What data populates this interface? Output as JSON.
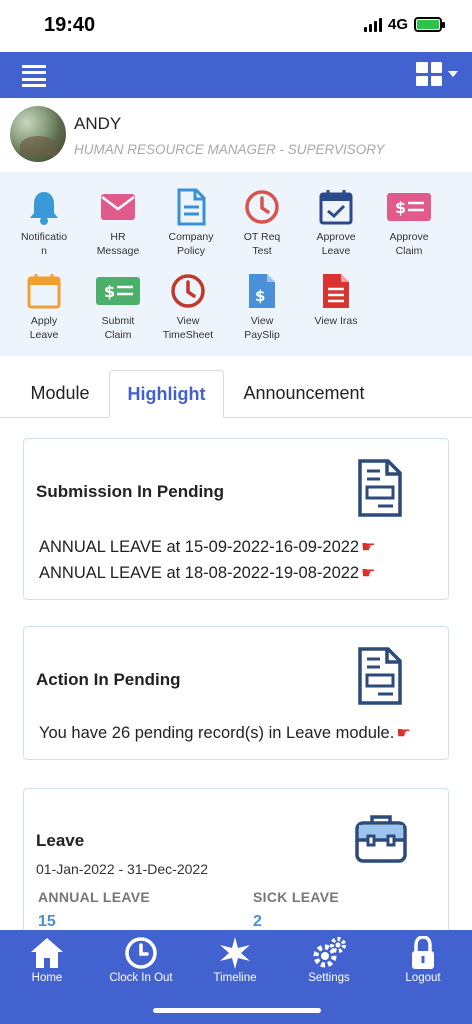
{
  "status": {
    "time": "19:40",
    "network": "4G",
    "battery_level": 0.9
  },
  "header": {
    "menu_icon": "hamburger-icon",
    "apps_icon": "grid-icon"
  },
  "profile": {
    "name": "ANDY",
    "role": "HUMAN RESOURCE MANAGER - SUPERVISORY"
  },
  "quick_actions": [
    {
      "label": "Notificatio\nn",
      "icon": "bell-icon",
      "color": "#3a9ad9"
    },
    {
      "label": "HR\nMessage",
      "icon": "envelope-icon",
      "color": "#e05a8a"
    },
    {
      "label": "Company\nPolicy",
      "icon": "document-icon",
      "color": "#3a8fd9"
    },
    {
      "label": "OT Req\nTest",
      "icon": "clock-icon",
      "color": "#d9534f"
    },
    {
      "label": "Approve\nLeave",
      "icon": "calendar-check-icon",
      "color": "#2c4a8a"
    },
    {
      "label": "Approve\nClaim",
      "icon": "money-bill-icon",
      "color": "#e05a8a"
    },
    {
      "label": "Apply\nLeave",
      "icon": "calendar-icon",
      "color": "#f0a030"
    },
    {
      "label": "Submit\nClaim",
      "icon": "money-bill-icon",
      "color": "#4caf6a"
    },
    {
      "label": "View\nTimeSheet",
      "icon": "clock-icon",
      "color": "#c0392b"
    },
    {
      "label": "View\nPaySlip",
      "icon": "payslip-icon",
      "color": "#4a90d9"
    },
    {
      "label": "View Iras",
      "icon": "document-text-icon",
      "color": "#d9342f"
    }
  ],
  "tabs": [
    "Module",
    "Highlight",
    "Announcement"
  ],
  "active_tab": "Highlight",
  "cards": {
    "submission": {
      "title": "Submission In Pending",
      "items": [
        "ANNUAL LEAVE at 15-09-2022-16-09-2022",
        "ANNUAL LEAVE at 18-08-2022-19-08-2022"
      ]
    },
    "action": {
      "title": "Action In Pending",
      "text": "You have 26 pending record(s) in Leave module."
    },
    "leave": {
      "title": "Leave",
      "period": "01-Jan-2022 - 31-Dec-2022",
      "types": [
        {
          "label": "ANNUAL LEAVE",
          "value": "15"
        },
        {
          "label": "SICK LEAVE",
          "value": "2"
        }
      ]
    }
  },
  "bottom_nav": [
    {
      "label": "Home",
      "icon": "home-icon"
    },
    {
      "label": "Clock In Out",
      "icon": "clock-icon"
    },
    {
      "label": "Timeline",
      "icon": "star-icon"
    },
    {
      "label": "Settings",
      "icon": "gears-icon"
    },
    {
      "label": "Logout",
      "icon": "lock-icon"
    }
  ],
  "colors": {
    "primary": "#4262d0",
    "panel": "#edf4fb",
    "link_value": "#4a90d9"
  }
}
